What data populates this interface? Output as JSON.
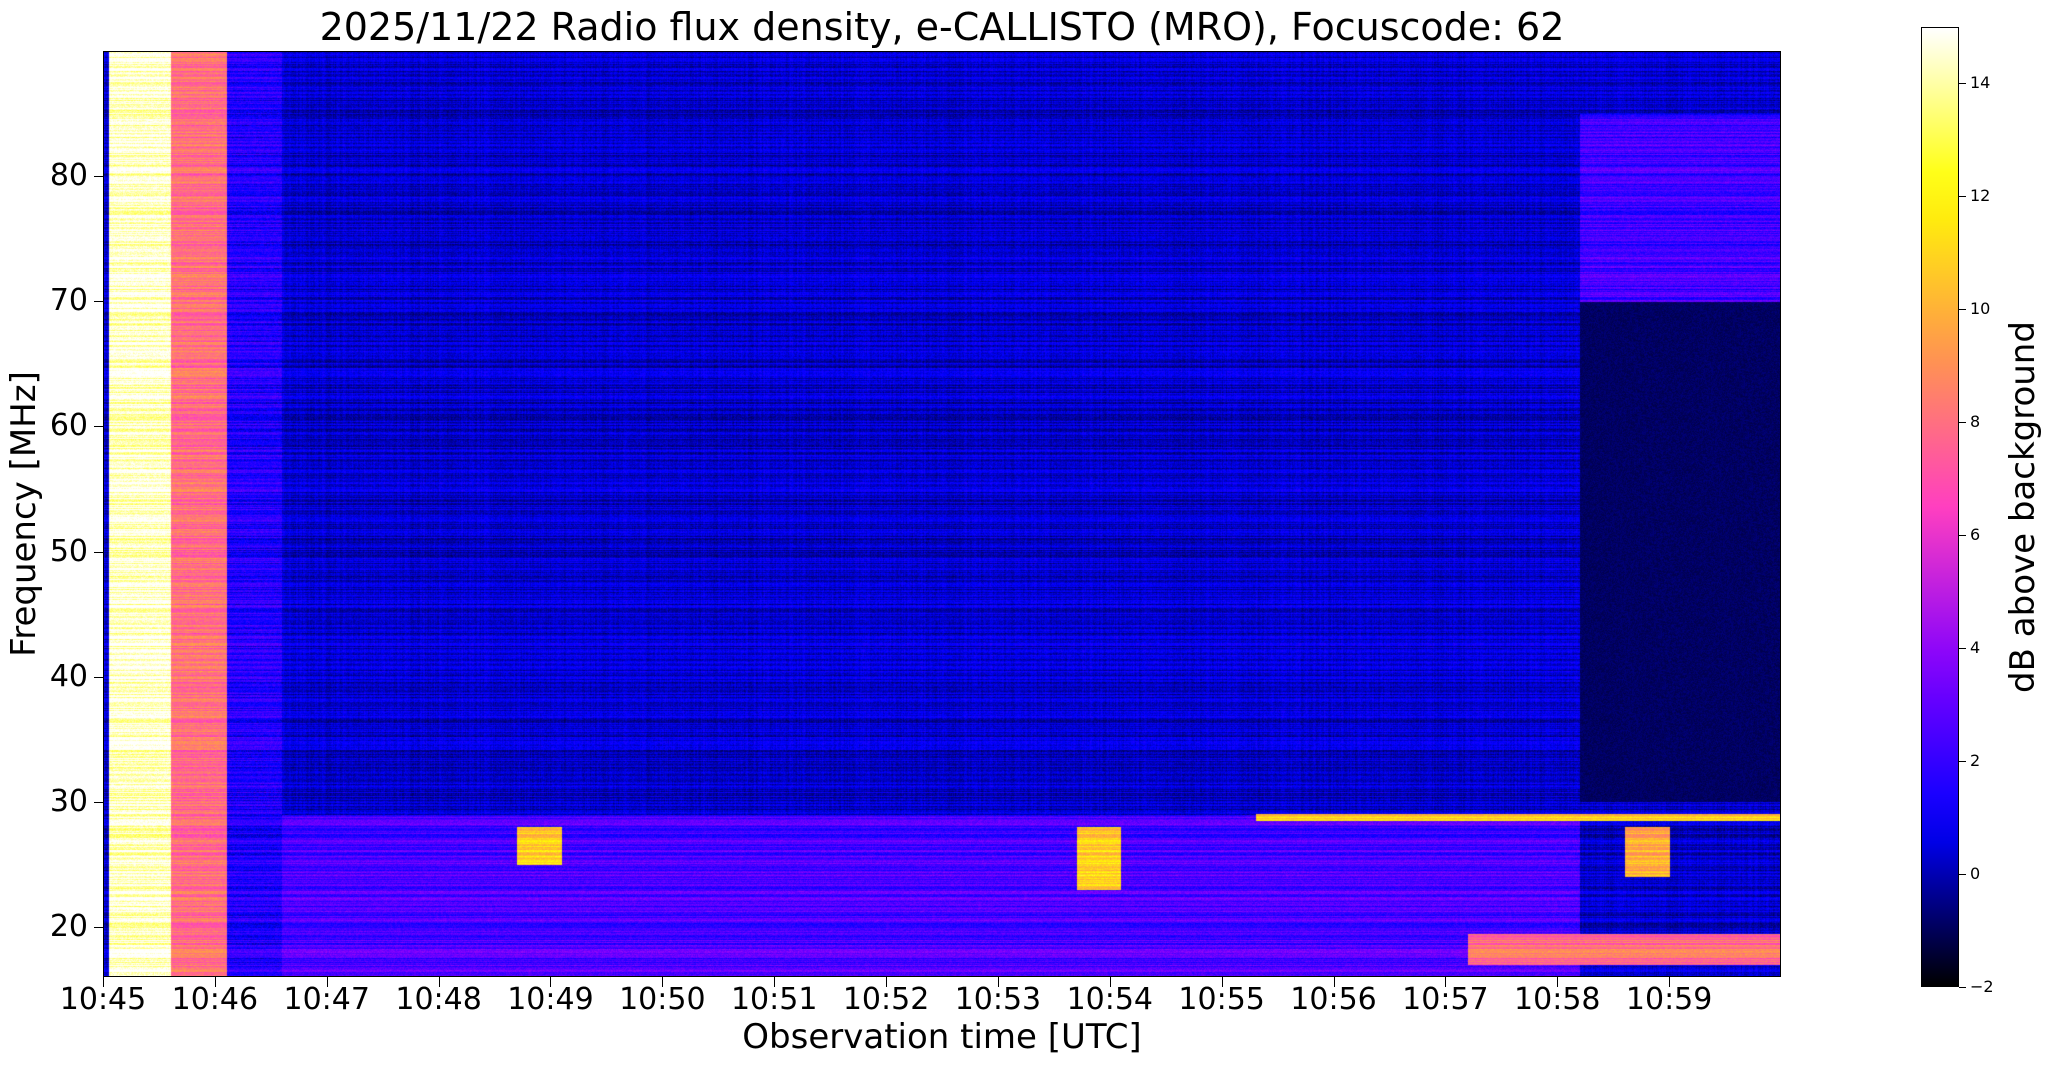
{
  "chart_data": {
    "type": "heatmap",
    "title": "2025/11/22  Radio flux density, e-CALLISTO (MRO), Focuscode: 62",
    "xlabel": "Observation time [UTC]",
    "ylabel": "Frequency [MHz]",
    "colorbar_label": "dB above background",
    "x_ticks": [
      "10:45",
      "10:46",
      "10:47",
      "10:48",
      "10:49",
      "10:50",
      "10:51",
      "10:52",
      "10:53",
      "10:54",
      "10:55",
      "10:56",
      "10:57",
      "10:58",
      "10:59"
    ],
    "x_range_minutes": [
      0,
      15
    ],
    "y_ticks": [
      20,
      30,
      40,
      50,
      60,
      70,
      80
    ],
    "ylim": [
      16,
      90
    ],
    "colorbar_ticks": [
      -2,
      0,
      2,
      4,
      6,
      8,
      10,
      12,
      14
    ],
    "color_range": [
      -2,
      15
    ],
    "colormap": "gnuplot2",
    "colormap_stops": [
      "#000000",
      "#0000ff",
      "#8000ff",
      "#ff3fc0",
      "#ff9a48",
      "#ffff00",
      "#ffffff"
    ],
    "grid": false,
    "background_level_db": 0.3,
    "features": [
      {
        "t_start": 0.05,
        "t_end": 0.6,
        "f_start": 16,
        "f_end": 90,
        "level_db": 14.5,
        "note": "saturated start"
      },
      {
        "t_start": 0.6,
        "t_end": 1.1,
        "f_start": 16,
        "f_end": 90,
        "level_db": 8,
        "note": "strong emission"
      },
      {
        "t_start": 1.1,
        "t_end": 1.6,
        "f_start": 16,
        "f_end": 90,
        "level_db": 1.5,
        "note": "moderate emission"
      },
      {
        "t_start": 1.6,
        "t_end": 13.2,
        "f_start": 16,
        "f_end": 29,
        "level_db": 2.5,
        "note": "low frequency interference"
      },
      {
        "t_start": 13.2,
        "t_end": 15,
        "f_start": 70,
        "f_end": 85,
        "level_db": 2.2,
        "note": "band enhancement"
      },
      {
        "t_start": 12.2,
        "t_end": 15,
        "f_start": 17,
        "f_end": 19.5,
        "level_db": 8,
        "note": "late emission"
      },
      {
        "t_start": 10.3,
        "t_end": 15,
        "f_start": 28.5,
        "f_end": 29.1,
        "level_db": 11,
        "note": "29 MHz line"
      },
      {
        "t_start": 3.7,
        "t_end": 4.1,
        "f_start": 25,
        "f_end": 28,
        "level_db": 11,
        "note": "drifting feature"
      },
      {
        "t_start": 8.7,
        "t_end": 9.1,
        "f_start": 23,
        "f_end": 28,
        "level_db": 11,
        "note": "drifting feature"
      },
      {
        "t_start": 13.6,
        "t_end": 14.0,
        "f_start": 24,
        "f_end": 28,
        "level_db": 10,
        "note": "drifting feature"
      }
    ]
  }
}
